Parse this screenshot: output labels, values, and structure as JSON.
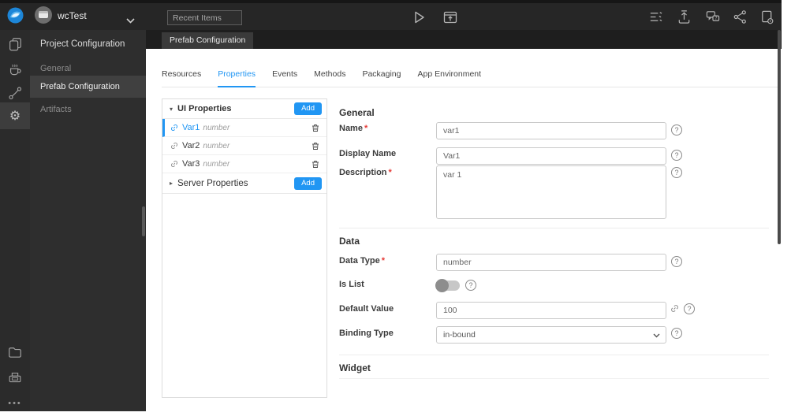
{
  "colors": {
    "accent": "#2196f3",
    "topbar_bg": "#262626",
    "sidebar_bg": "#2e2e2e"
  },
  "icons": {
    "help": "?",
    "caret_down": "▾",
    "caret_right": "▸",
    "more": "•••"
  },
  "topbar": {
    "project_name": "wcTest",
    "recent_items_placeholder": "Recent Items"
  },
  "sidebar": {
    "title": "Project Configuration",
    "items": [
      {
        "label": "General",
        "active": false
      },
      {
        "label": "Prefab Configuration",
        "active": true
      },
      {
        "label": "Artifacts",
        "active": false
      }
    ]
  },
  "document_tab": {
    "label": "Prefab Configuration"
  },
  "tabs": [
    {
      "label": "Resources",
      "active": false
    },
    {
      "label": "Properties",
      "active": true
    },
    {
      "label": "Events",
      "active": false
    },
    {
      "label": "Methods",
      "active": false
    },
    {
      "label": "Packaging",
      "active": false
    },
    {
      "label": "App Environment",
      "active": false
    }
  ],
  "properties_panel": {
    "ui_group": {
      "label": "UI Properties",
      "add_label": "Add",
      "expanded": true
    },
    "items": [
      {
        "name": "Var1",
        "type": "number",
        "selected": true
      },
      {
        "name": "Var2",
        "type": "number",
        "selected": false
      },
      {
        "name": "Var3",
        "type": "number",
        "selected": false
      }
    ],
    "server_group": {
      "label": "Server Properties",
      "add_label": "Add",
      "expanded": false
    }
  },
  "form": {
    "required_marker": "*",
    "general": {
      "title": "General",
      "name_label": "Name",
      "name_value": "var1",
      "display_name_label": "Display Name",
      "display_name_value": "Var1",
      "description_label": "Description",
      "description_value": "var 1"
    },
    "data": {
      "title": "Data",
      "data_type_label": "Data Type",
      "data_type_value": "number",
      "is_list_label": "Is List",
      "is_list_state": "off",
      "default_value_label": "Default Value",
      "default_value_value": "100",
      "binding_type_label": "Binding Type",
      "binding_type_value": "in-bound"
    },
    "widget": {
      "title": "Widget"
    }
  }
}
